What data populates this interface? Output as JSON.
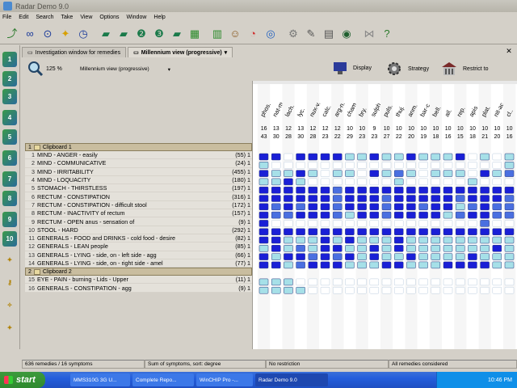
{
  "window": {
    "title": "Radar Demo 9.0"
  },
  "menu": [
    "File",
    "Edit",
    "Search",
    "Take",
    "View",
    "Options",
    "Window",
    "Help"
  ],
  "toolbar_icons": [
    "open-icon",
    "binoculars-icon",
    "glasses-icon",
    "bulb-icon",
    "clock-icon",
    "book-icon",
    "book-icon",
    "book-2-icon",
    "book-3-icon",
    "book-icon",
    "grid-icon",
    "library-icon",
    "monkey-icon",
    "pie-icon",
    "target-icon",
    "gear-icon",
    "pen-icon",
    "doc-icon",
    "globe-icon",
    "network-icon",
    "help-icon"
  ],
  "left_toolbar": {
    "numbers": [
      "1",
      "2",
      "3",
      "4",
      "5",
      "6",
      "7",
      "8",
      "9",
      "10"
    ]
  },
  "tabs": [
    {
      "label": "Investigation window for remedies",
      "active": false
    },
    {
      "label": "Millennium view (progressive)",
      "active": true
    }
  ],
  "view": {
    "zoom": "125 %",
    "select_value": "Millennium view (progressive)",
    "buttons": [
      {
        "label": "Display"
      },
      {
        "label": "Strategy"
      },
      {
        "label": "Restrict to"
      }
    ]
  },
  "clipboards": [
    {
      "number": "1",
      "title": "Clipboard 1",
      "rows": [
        {
          "n": "1",
          "label": "MIND - ANGER - easily",
          "count": "(55) 1"
        },
        {
          "n": "2",
          "label": "MIND - COMMUNICATIVE",
          "count": "(24) 1"
        },
        {
          "n": "3",
          "label": "MIND - IRRITABILITY",
          "count": "(455) 1"
        },
        {
          "n": "4",
          "label": "MIND - LOQUACITY",
          "count": "(180) 1"
        },
        {
          "n": "5",
          "label": "STOMACH - THIRSTLESS",
          "count": "(197) 1"
        },
        {
          "n": "6",
          "label": "RECTUM - CONSTIPATION",
          "count": "(316) 1"
        },
        {
          "n": "7",
          "label": "RECTUM - CONSTIPATION - difficult stool",
          "count": "(172) 1"
        },
        {
          "n": "8",
          "label": "RECTUM - INACTIVITY of rectum",
          "count": "(157) 1"
        },
        {
          "n": "9",
          "label": "RECTUM - OPEN anus - sensation of",
          "count": "(9) 1"
        },
        {
          "n": "10",
          "label": "STOOL - HARD",
          "count": "(292) 1"
        },
        {
          "n": "11",
          "label": "GENERALS - FOOD and DRINKS - cold food - desire",
          "count": "(82) 1"
        },
        {
          "n": "12",
          "label": "GENERALS - LEAN people",
          "count": "(85) 1"
        },
        {
          "n": "13",
          "label": "GENERALS - LYING - side, on - left side - agg",
          "count": "(66) 1"
        },
        {
          "n": "14",
          "label": "GENERALS - LYING - side, on - right side - amel",
          "count": "(77) 1"
        }
      ]
    },
    {
      "number": "2",
      "title": "Clipboard 2",
      "rows": [
        {
          "n": "15",
          "label": "EYE - PAIN - burning - Lids - Upper",
          "count": "(11) 1"
        },
        {
          "n": "16",
          "label": "GENERALS - CONSTIPATION - agg",
          "count": "(9) 1"
        }
      ]
    }
  ],
  "remedies": [
    {
      "abbr": "phos.",
      "hits": "16",
      "score": "43"
    },
    {
      "abbr": "nat-m.",
      "hits": "13",
      "score": "30"
    },
    {
      "abbr": "lach.",
      "hits": "12",
      "score": "28"
    },
    {
      "abbr": "lyc.",
      "hits": "13",
      "score": "30"
    },
    {
      "abbr": "nux-v.",
      "hits": "12",
      "score": "28"
    },
    {
      "abbr": "calc.",
      "hits": "12",
      "score": "23"
    },
    {
      "abbr": "arg-n.",
      "hits": "12",
      "score": "22"
    },
    {
      "abbr": "cham.",
      "hits": "10",
      "score": "29"
    },
    {
      "abbr": "bry.",
      "hits": "10",
      "score": "23"
    },
    {
      "abbr": "sulph.",
      "hits": "9",
      "score": "23"
    },
    {
      "abbr": "puls.",
      "hits": "10",
      "score": "27"
    },
    {
      "abbr": "thuj.",
      "hits": "10",
      "score": "22"
    },
    {
      "abbr": "anm.",
      "hits": "10",
      "score": "20"
    },
    {
      "abbr": "bar-c.",
      "hits": "10",
      "score": "19"
    },
    {
      "abbr": "bell.",
      "hits": "10",
      "score": "18"
    },
    {
      "abbr": "ail.",
      "hits": "10",
      "score": "16"
    },
    {
      "abbr": "rep.",
      "hits": "10",
      "score": "15"
    },
    {
      "abbr": "apis",
      "hits": "10",
      "score": "18"
    },
    {
      "abbr": "plat.",
      "hits": "10",
      "score": "21"
    },
    {
      "abbr": "nit-ac.",
      "hits": "10",
      "score": "20"
    },
    {
      "abbr": "cl..",
      "hits": "10",
      "score": "16"
    }
  ],
  "grid": {
    "note": "grades per remedy column (0 = none, 1 = light, 2 = medium, 3 = dark)",
    "values": [
      [
        3,
        3,
        0,
        3,
        3,
        3,
        3,
        1,
        1,
        3,
        1,
        1,
        3,
        1,
        1,
        1,
        3,
        0,
        1,
        0,
        1
      ],
      [
        1,
        0,
        0,
        0,
        0,
        0,
        0,
        0,
        0,
        0,
        0,
        0,
        0,
        0,
        0,
        0,
        0,
        0,
        0,
        0,
        1
      ],
      [
        3,
        1,
        1,
        3,
        1,
        0,
        1,
        1,
        0,
        3,
        1,
        2,
        1,
        0,
        1,
        1,
        1,
        0,
        3,
        1,
        2
      ],
      [
        1,
        1,
        3,
        1,
        0,
        0,
        0,
        0,
        0,
        0,
        0,
        1,
        0,
        0,
        0,
        0,
        0,
        1,
        0,
        0,
        0
      ],
      [
        3,
        3,
        3,
        3,
        3,
        3,
        2,
        3,
        3,
        3,
        3,
        3,
        3,
        3,
        3,
        3,
        3,
        3,
        3,
        3,
        3
      ],
      [
        3,
        3,
        3,
        3,
        3,
        3,
        2,
        3,
        3,
        3,
        2,
        3,
        3,
        3,
        3,
        3,
        2,
        3,
        3,
        3,
        2
      ],
      [
        3,
        2,
        3,
        2,
        3,
        3,
        2,
        3,
        3,
        3,
        2,
        3,
        3,
        2,
        3,
        3,
        1,
        2,
        3,
        2,
        2
      ],
      [
        3,
        2,
        2,
        3,
        3,
        3,
        2,
        1,
        3,
        3,
        2,
        3,
        3,
        3,
        3,
        1,
        2,
        3,
        3,
        2,
        2
      ],
      [
        3,
        0,
        0,
        0,
        0,
        0,
        0,
        0,
        0,
        0,
        0,
        0,
        0,
        0,
        0,
        0,
        0,
        0,
        2,
        0,
        0
      ],
      [
        3,
        3,
        3,
        3,
        3,
        3,
        3,
        3,
        3,
        3,
        3,
        3,
        3,
        3,
        3,
        3,
        3,
        3,
        3,
        3,
        3
      ],
      [
        3,
        3,
        1,
        1,
        1,
        3,
        1,
        3,
        1,
        1,
        1,
        3,
        1,
        1,
        1,
        1,
        1,
        1,
        1,
        1,
        1
      ],
      [
        1,
        3,
        1,
        2,
        1,
        3,
        3,
        1,
        1,
        3,
        1,
        3,
        1,
        1,
        1,
        1,
        1,
        1,
        1,
        3,
        1
      ],
      [
        3,
        1,
        3,
        3,
        2,
        3,
        2,
        3,
        1,
        3,
        1,
        1,
        3,
        1,
        1,
        1,
        1,
        3,
        1,
        1,
        1
      ],
      [
        3,
        3,
        1,
        2,
        3,
        3,
        3,
        1,
        1,
        1,
        3,
        3,
        1,
        1,
        1,
        3,
        3,
        3,
        3,
        1,
        1
      ],
      [
        1,
        1,
        1,
        0,
        0,
        0,
        0,
        0,
        0,
        0,
        0,
        0,
        0,
        0,
        0,
        0,
        0,
        0,
        0,
        0,
        0
      ],
      [
        1,
        1,
        1,
        1,
        0,
        0,
        0,
        0,
        0,
        0,
        0,
        0,
        0,
        0,
        0,
        0,
        0,
        0,
        0,
        0,
        0
      ]
    ]
  },
  "colors": {
    "dark": "#1a1fd6",
    "medium": "#4a6fe0",
    "light": "#a6e0e8",
    "none": "#ffffff"
  },
  "status": {
    "remedies": "636 remedies / 16 symptoms",
    "sort": "Sum of symptoms, sort: degree",
    "restriction": "No restriction",
    "considered": "All remedies considered"
  },
  "taskbar": {
    "start": "start",
    "tasks": [
      {
        "label": "MMS310G 3G U...",
        "active": false
      },
      {
        "label": "Complete Repo...",
        "active": false
      },
      {
        "label": "WinCHIP Pro -...",
        "active": false
      },
      {
        "label": "Radar Demo 9.0",
        "active": true
      }
    ],
    "clock": "10:46 PM"
  }
}
